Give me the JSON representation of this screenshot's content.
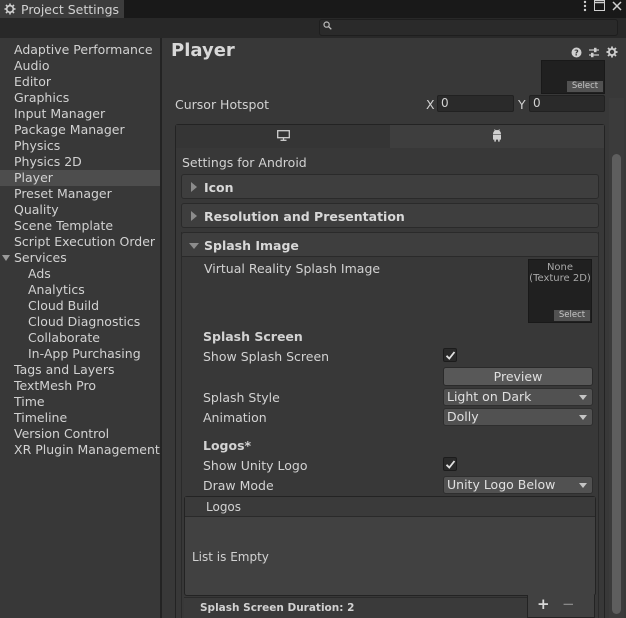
{
  "window": {
    "tab_title": "Project Settings",
    "controls": [
      "more-options",
      "maximize",
      "close"
    ]
  },
  "search": {
    "placeholder": ""
  },
  "sidebar": {
    "items": [
      {
        "label": "Adaptive Performance",
        "indent": 0
      },
      {
        "label": "Audio",
        "indent": 0
      },
      {
        "label": "Editor",
        "indent": 0
      },
      {
        "label": "Graphics",
        "indent": 0
      },
      {
        "label": "Input Manager",
        "indent": 0
      },
      {
        "label": "Package Manager",
        "indent": 0
      },
      {
        "label": "Physics",
        "indent": 0
      },
      {
        "label": "Physics 2D",
        "indent": 0
      },
      {
        "label": "Player",
        "indent": 0,
        "selected": true
      },
      {
        "label": "Preset Manager",
        "indent": 0
      },
      {
        "label": "Quality",
        "indent": 0
      },
      {
        "label": "Scene Template",
        "indent": 0
      },
      {
        "label": "Script Execution Order",
        "indent": 0
      },
      {
        "label": "Services",
        "indent": 0,
        "expanded": true
      },
      {
        "label": "Ads",
        "indent": 1
      },
      {
        "label": "Analytics",
        "indent": 1
      },
      {
        "label": "Cloud Build",
        "indent": 1
      },
      {
        "label": "Cloud Diagnostics",
        "indent": 1
      },
      {
        "label": "Collaborate",
        "indent": 1
      },
      {
        "label": "In-App Purchasing",
        "indent": 1
      },
      {
        "label": "Tags and Layers",
        "indent": 0
      },
      {
        "label": "TextMesh Pro",
        "indent": 0
      },
      {
        "label": "Time",
        "indent": 0
      },
      {
        "label": "Timeline",
        "indent": 0
      },
      {
        "label": "Version Control",
        "indent": 0
      },
      {
        "label": "XR Plugin Management",
        "indent": 0
      }
    ]
  },
  "main": {
    "title": "Player",
    "header_icons": [
      "help-icon",
      "presets-icon",
      "settings-gear-icon"
    ],
    "cursor_texture_select": "Select",
    "cursor_hotspot": {
      "label": "Cursor Hotspot",
      "x_label": "X",
      "x_value": "0",
      "y_label": "Y",
      "y_value": "0"
    },
    "platform_tabs": [
      {
        "icon": "monitor-icon",
        "active": false
      },
      {
        "icon": "android-icon",
        "active": true
      }
    ],
    "settings_for": "Settings for Android",
    "sections": {
      "icon": "Icon",
      "resolution": "Resolution and Presentation",
      "splash": "Splash Image"
    },
    "splash": {
      "vr_label": "Virtual Reality Splash Image",
      "vr_texture_line1": "None",
      "vr_texture_line2": "(Texture 2D)",
      "vr_select": "Select",
      "splash_screen_heading": "Splash Screen",
      "show_splash_label": "Show Splash Screen",
      "show_splash_checked": true,
      "preview_button": "Preview",
      "splash_style_label": "Splash Style",
      "splash_style_value": "Light on Dark",
      "animation_label": "Animation",
      "animation_value": "Dolly",
      "logos_heading": "Logos*",
      "show_unity_logo_label": "Show Unity Logo",
      "show_unity_logo_checked": true,
      "draw_mode_label": "Draw Mode",
      "draw_mode_value": "Unity Logo Below",
      "logos_list_header": "Logos",
      "logos_list_empty": "List is Empty",
      "duration_label": "Splash Screen Duration: 2",
      "add_symbol": "+",
      "remove_symbol": "−"
    }
  },
  "colors": {
    "background": "#383838",
    "selected_row": "#4d4d4d",
    "field_bg": "#2a2a2a",
    "text": "#d2d2d2"
  }
}
